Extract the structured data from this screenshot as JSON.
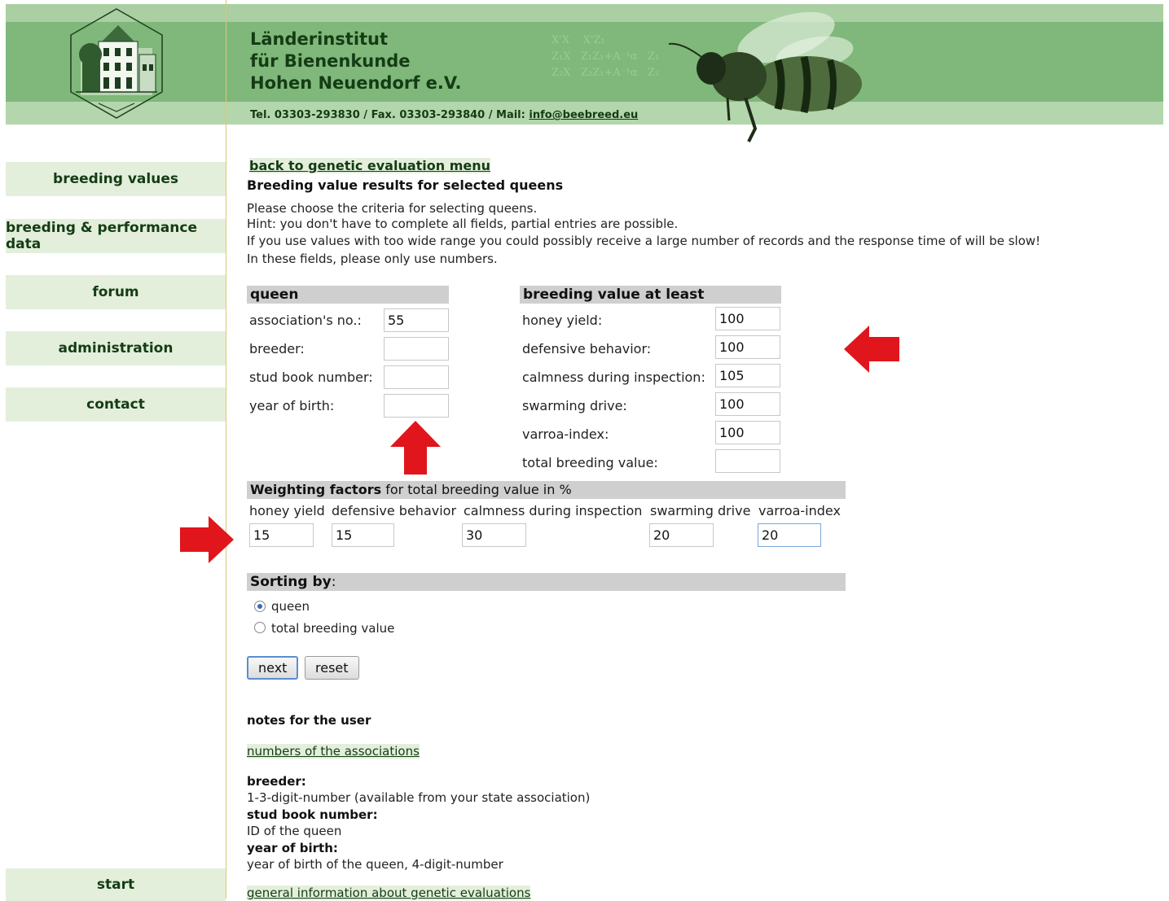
{
  "header": {
    "title_line1": "Länderinstitut",
    "title_line2": "für Bienenkunde",
    "title_line3": "Hohen Neuendorf e.V.",
    "contact_prefix": "Tel. 03303-293830 / Fax. 03303-293840 / Mail: ",
    "contact_email": "info@beebreed.eu",
    "formula_text": "X'X    X'Z₁\nZ₁X   Z₁Z₁+A⁻¹α   Z₁\nZ₂X   Z₂Z₁+A⁻¹α   Z₂"
  },
  "nav": {
    "items": [
      "breeding values",
      "breeding & performance data",
      "forum",
      "administration",
      "contact"
    ],
    "start": "start"
  },
  "main": {
    "back_link": "back to genetic evaluation menu",
    "heading": "Breeding value results for selected queens",
    "intro": [
      "Please choose the criteria for selecting queens.",
      "Hint: you don't have to complete all fields, partial entries are possible.",
      "If you use values with too wide range you could possibly receive a large number of records and the response time of will be slow!",
      "In these fields, please only use numbers."
    ],
    "queen": {
      "header": "queen",
      "fields": [
        {
          "label": "association's no.:",
          "value": "55"
        },
        {
          "label": "breeder:",
          "value": ""
        },
        {
          "label": "stud book number:",
          "value": ""
        },
        {
          "label": "year of birth:",
          "value": ""
        }
      ]
    },
    "breeding": {
      "header": "breeding value at least",
      "fields": [
        {
          "label": "honey yield:",
          "value": "100"
        },
        {
          "label": "defensive behavior:",
          "value": "100"
        },
        {
          "label": "calmness during inspection:",
          "value": "105"
        },
        {
          "label": "swarming drive:",
          "value": "100"
        },
        {
          "label": "varroa-index:",
          "value": "100"
        },
        {
          "label": "total breeding value:",
          "value": ""
        }
      ]
    },
    "weighting": {
      "header_bold": "Weighting factors",
      "header_rest": " for total breeding value in %",
      "columns": [
        "honey yield",
        "defensive behavior",
        "calmness during inspection",
        "swarming drive",
        "varroa-index"
      ],
      "values": [
        "15",
        "15",
        "30",
        "20",
        "20"
      ]
    },
    "sorting": {
      "header": "Sorting by",
      "colon": ":",
      "options": [
        "queen",
        "total breeding value"
      ],
      "selected": "queen"
    },
    "buttons": {
      "next": "next",
      "reset": "reset"
    },
    "notes": {
      "heading": "notes for the user",
      "assoc_link": "numbers of the associations",
      "breeder_term": "breeder:",
      "breeder_desc": "1-3-digit-number (available from your state association)",
      "stud_term": "stud book number:",
      "stud_desc": "ID of the queen",
      "year_term": "year of birth:",
      "year_desc": "year of birth of the queen, 4-digit-number",
      "general_link": "general information about genetic evaluations"
    }
  },
  "colors": {
    "header_green": "#7fb87a",
    "nav_bg": "#e3efdb",
    "section_gray": "#cfcfcf",
    "arrow_red": "#e0161c"
  }
}
